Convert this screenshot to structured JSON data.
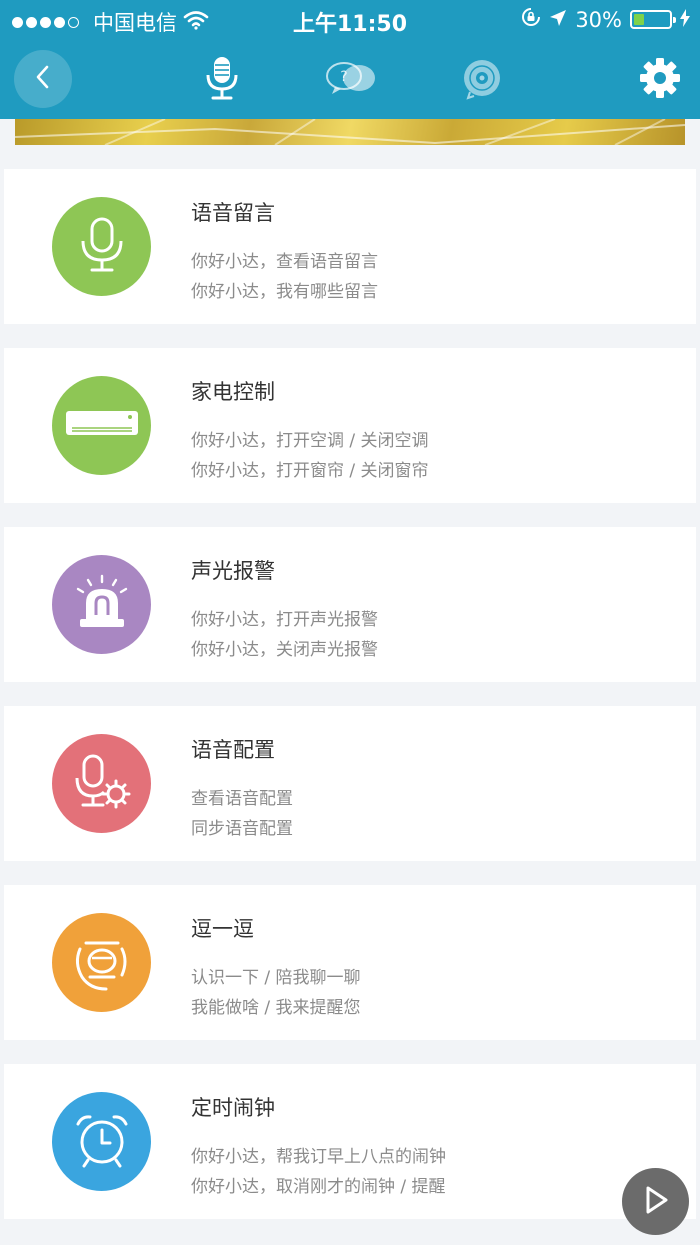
{
  "statusbar": {
    "carrier": "中国电信",
    "time": "上午11:50",
    "battery_text": "30%",
    "battery_level": 0.3
  },
  "navbar": {
    "back_icon": "chevron-left-icon",
    "tabs": [
      {
        "icon": "microphone-icon",
        "active": true
      },
      {
        "icon": "question-chat-icon",
        "active": false
      },
      {
        "icon": "music-disc-icon",
        "active": false
      }
    ],
    "settings_icon": "gear-icon"
  },
  "commands": [
    {
      "title": "语音留言",
      "line1": "你好小达，查看语音留言",
      "line2": "你好小达，我有哪些留言",
      "icon": "microphone-icon",
      "color": "#8ec655"
    },
    {
      "title": "家电控制",
      "line1": "你好小达，打开空调 / 关闭空调",
      "line2": "你好小达，打开窗帘 / 关闭窗帘",
      "icon": "air-conditioner-icon",
      "color": "#8ec655"
    },
    {
      "title": "声光报警",
      "line1": "你好小达，打开声光报警",
      "line2": "你好小达，关闭声光报警",
      "icon": "alarm-light-icon",
      "color": "#a987c2"
    },
    {
      "title": "语音配置",
      "line1": "查看语音配置",
      "line2": "同步语音配置",
      "icon": "microphone-gear-icon",
      "color": "#e37179"
    },
    {
      "title": "逗一逗",
      "line1": "认识一下 / 陪我聊一聊",
      "line2": "我能做啥 / 我来提醒您",
      "icon": "robot-face-icon",
      "color": "#f0a13a"
    },
    {
      "title": "定时闹钟",
      "line1": "你好小达，帮我订早上八点的闹钟",
      "line2": "你好小达，取消刚才的闹钟 / 提醒",
      "icon": "alarm-clock-icon",
      "color": "#3aa5df"
    }
  ],
  "floating": {
    "icon": "play-icon"
  }
}
